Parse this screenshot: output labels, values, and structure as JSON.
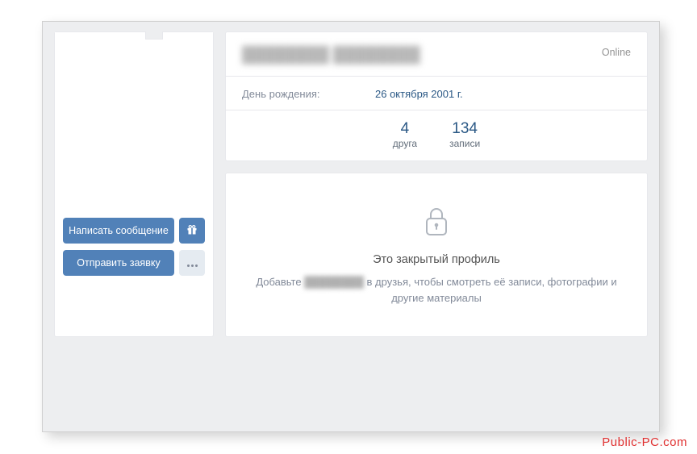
{
  "sidebar": {
    "message_button": "Написать сообщение",
    "request_button": "Отправить заявку",
    "gift_icon": "gift-icon",
    "more_icon": "more-icon"
  },
  "profile": {
    "name": "████████ ████████",
    "status": "Online",
    "birthday_label": "День рождения:",
    "birthday_value": "26 октября 2001 г."
  },
  "counters": {
    "friends_count": "4",
    "friends_label": "друга",
    "posts_count": "134",
    "posts_label": "записи"
  },
  "private": {
    "title": "Это закрытый профиль",
    "text_prefix": "Добавьте",
    "text_name": "████████",
    "text_suffix": "в друзья, чтобы смотреть её записи, фотографии и другие материалы"
  },
  "watermark": "Public-PC.com"
}
